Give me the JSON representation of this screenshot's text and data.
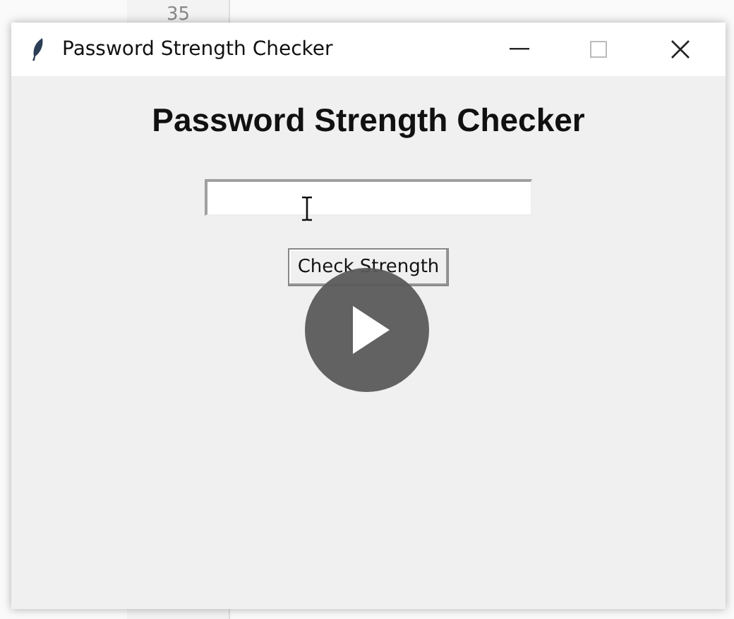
{
  "editor": {
    "line_number": "35"
  },
  "window": {
    "title": "Password Strength Checker"
  },
  "heading": "Password Strength Checker",
  "button": "Check Strength"
}
